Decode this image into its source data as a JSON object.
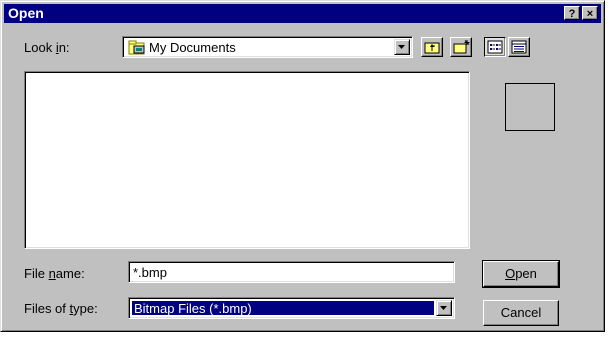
{
  "window": {
    "title": "Open",
    "help_button": "?",
    "close_button": "×"
  },
  "look_in": {
    "label_pre": "Look ",
    "label_accel": "i",
    "label_post": "n:",
    "value": "My Documents",
    "icon": "folder-icon"
  },
  "toolbar": {
    "buttons": [
      {
        "name": "up-one-level-icon"
      },
      {
        "name": "new-folder-icon"
      },
      {
        "name": "list-view-icon"
      },
      {
        "name": "details-view-icon"
      }
    ]
  },
  "file_name": {
    "label_pre": "File ",
    "label_accel": "n",
    "label_post": "ame:",
    "value": "*.bmp"
  },
  "file_type": {
    "label_pre": "Files of ",
    "label_accel": "t",
    "label_post": "ype:",
    "value": "Bitmap Files (*.bmp)"
  },
  "buttons": {
    "open_accel": "O",
    "open_rest": "pen",
    "cancel": "Cancel"
  },
  "colors": {
    "title_bar": "#000080",
    "face": "#c0c0c0",
    "selection": "#000080"
  }
}
